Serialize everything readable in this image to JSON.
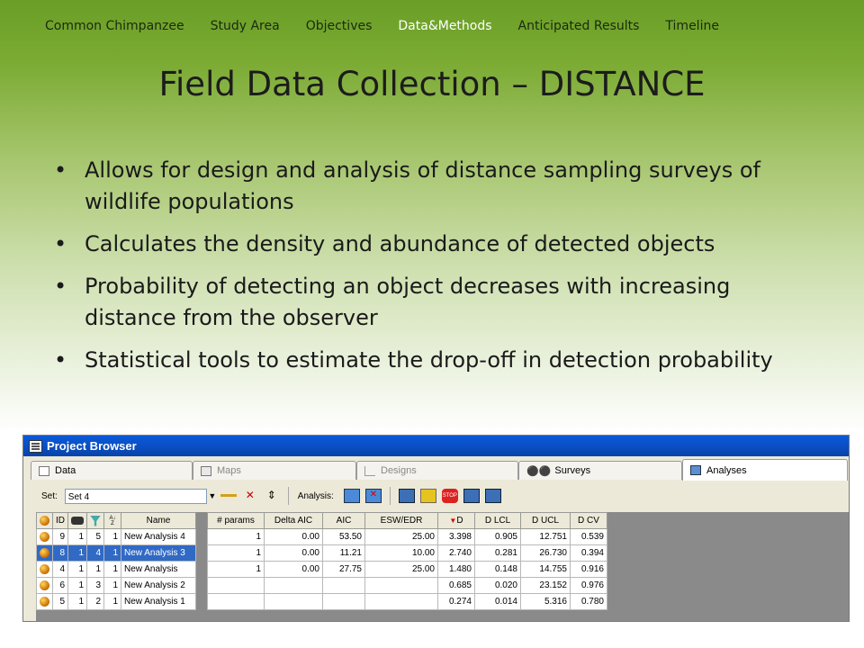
{
  "nav": [
    "Common Chimpanzee",
    "Study Area",
    "Objectives",
    "Data&Methods",
    "Anticipated Results",
    "Timeline"
  ],
  "nav_active": "Data&Methods",
  "title": "Field Data Collection – DISTANCE",
  "bullets": [
    "Allows for design and analysis of distance sampling surveys of wildlife populations",
    "Calculates the density and abundance of detected objects",
    "Probability of detecting an object decreases with increasing distance from the observer",
    "Statistical tools to estimate the drop-off in detection probability"
  ],
  "app": {
    "window_title": "Project Browser",
    "tabs": [
      "Data",
      "Maps",
      "Designs",
      "Surveys",
      "Analyses"
    ],
    "active_tab": "Analyses",
    "set_label": "Set:",
    "set_value": "Set 4",
    "analysis_label": "Analysis:",
    "left_columns": [
      "",
      "ID",
      "",
      "",
      "",
      "Name"
    ],
    "left_rows": [
      {
        "id": "9",
        "a": "1",
        "b": "5",
        "c": "1",
        "name": "New Analysis 4",
        "selected": false
      },
      {
        "id": "8",
        "a": "1",
        "b": "4",
        "c": "1",
        "name": "New Analysis 3",
        "selected": true
      },
      {
        "id": "4",
        "a": "1",
        "b": "1",
        "c": "1",
        "name": "New Analysis",
        "selected": false
      },
      {
        "id": "6",
        "a": "1",
        "b": "3",
        "c": "1",
        "name": "New Analysis 2",
        "selected": false
      },
      {
        "id": "5",
        "a": "1",
        "b": "2",
        "c": "1",
        "name": "New Analysis 1",
        "selected": false
      }
    ],
    "right_columns": [
      "# params",
      "Delta AIC",
      "AIC",
      "ESW/EDR",
      "D",
      "D LCL",
      "D UCL",
      "D CV"
    ],
    "right_rows": [
      [
        "1",
        "0.00",
        "53.50",
        "25.00",
        "3.398",
        "0.905",
        "12.751",
        "0.539"
      ],
      [
        "1",
        "0.00",
        "11.21",
        "10.00",
        "2.740",
        "0.281",
        "26.730",
        "0.394"
      ],
      [
        "1",
        "0.00",
        "27.75",
        "25.00",
        "1.480",
        "0.148",
        "14.755",
        "0.916"
      ],
      [
        "",
        "",
        "",
        "",
        "0.685",
        "0.020",
        "23.152",
        "0.976"
      ],
      [
        "",
        "",
        "",
        "",
        "0.274",
        "0.014",
        "5.316",
        "0.780"
      ]
    ],
    "colors": {
      "titlebar": "#0a4fc4",
      "selected_row": "#316ac5",
      "nav_active": "#ffffff"
    }
  }
}
